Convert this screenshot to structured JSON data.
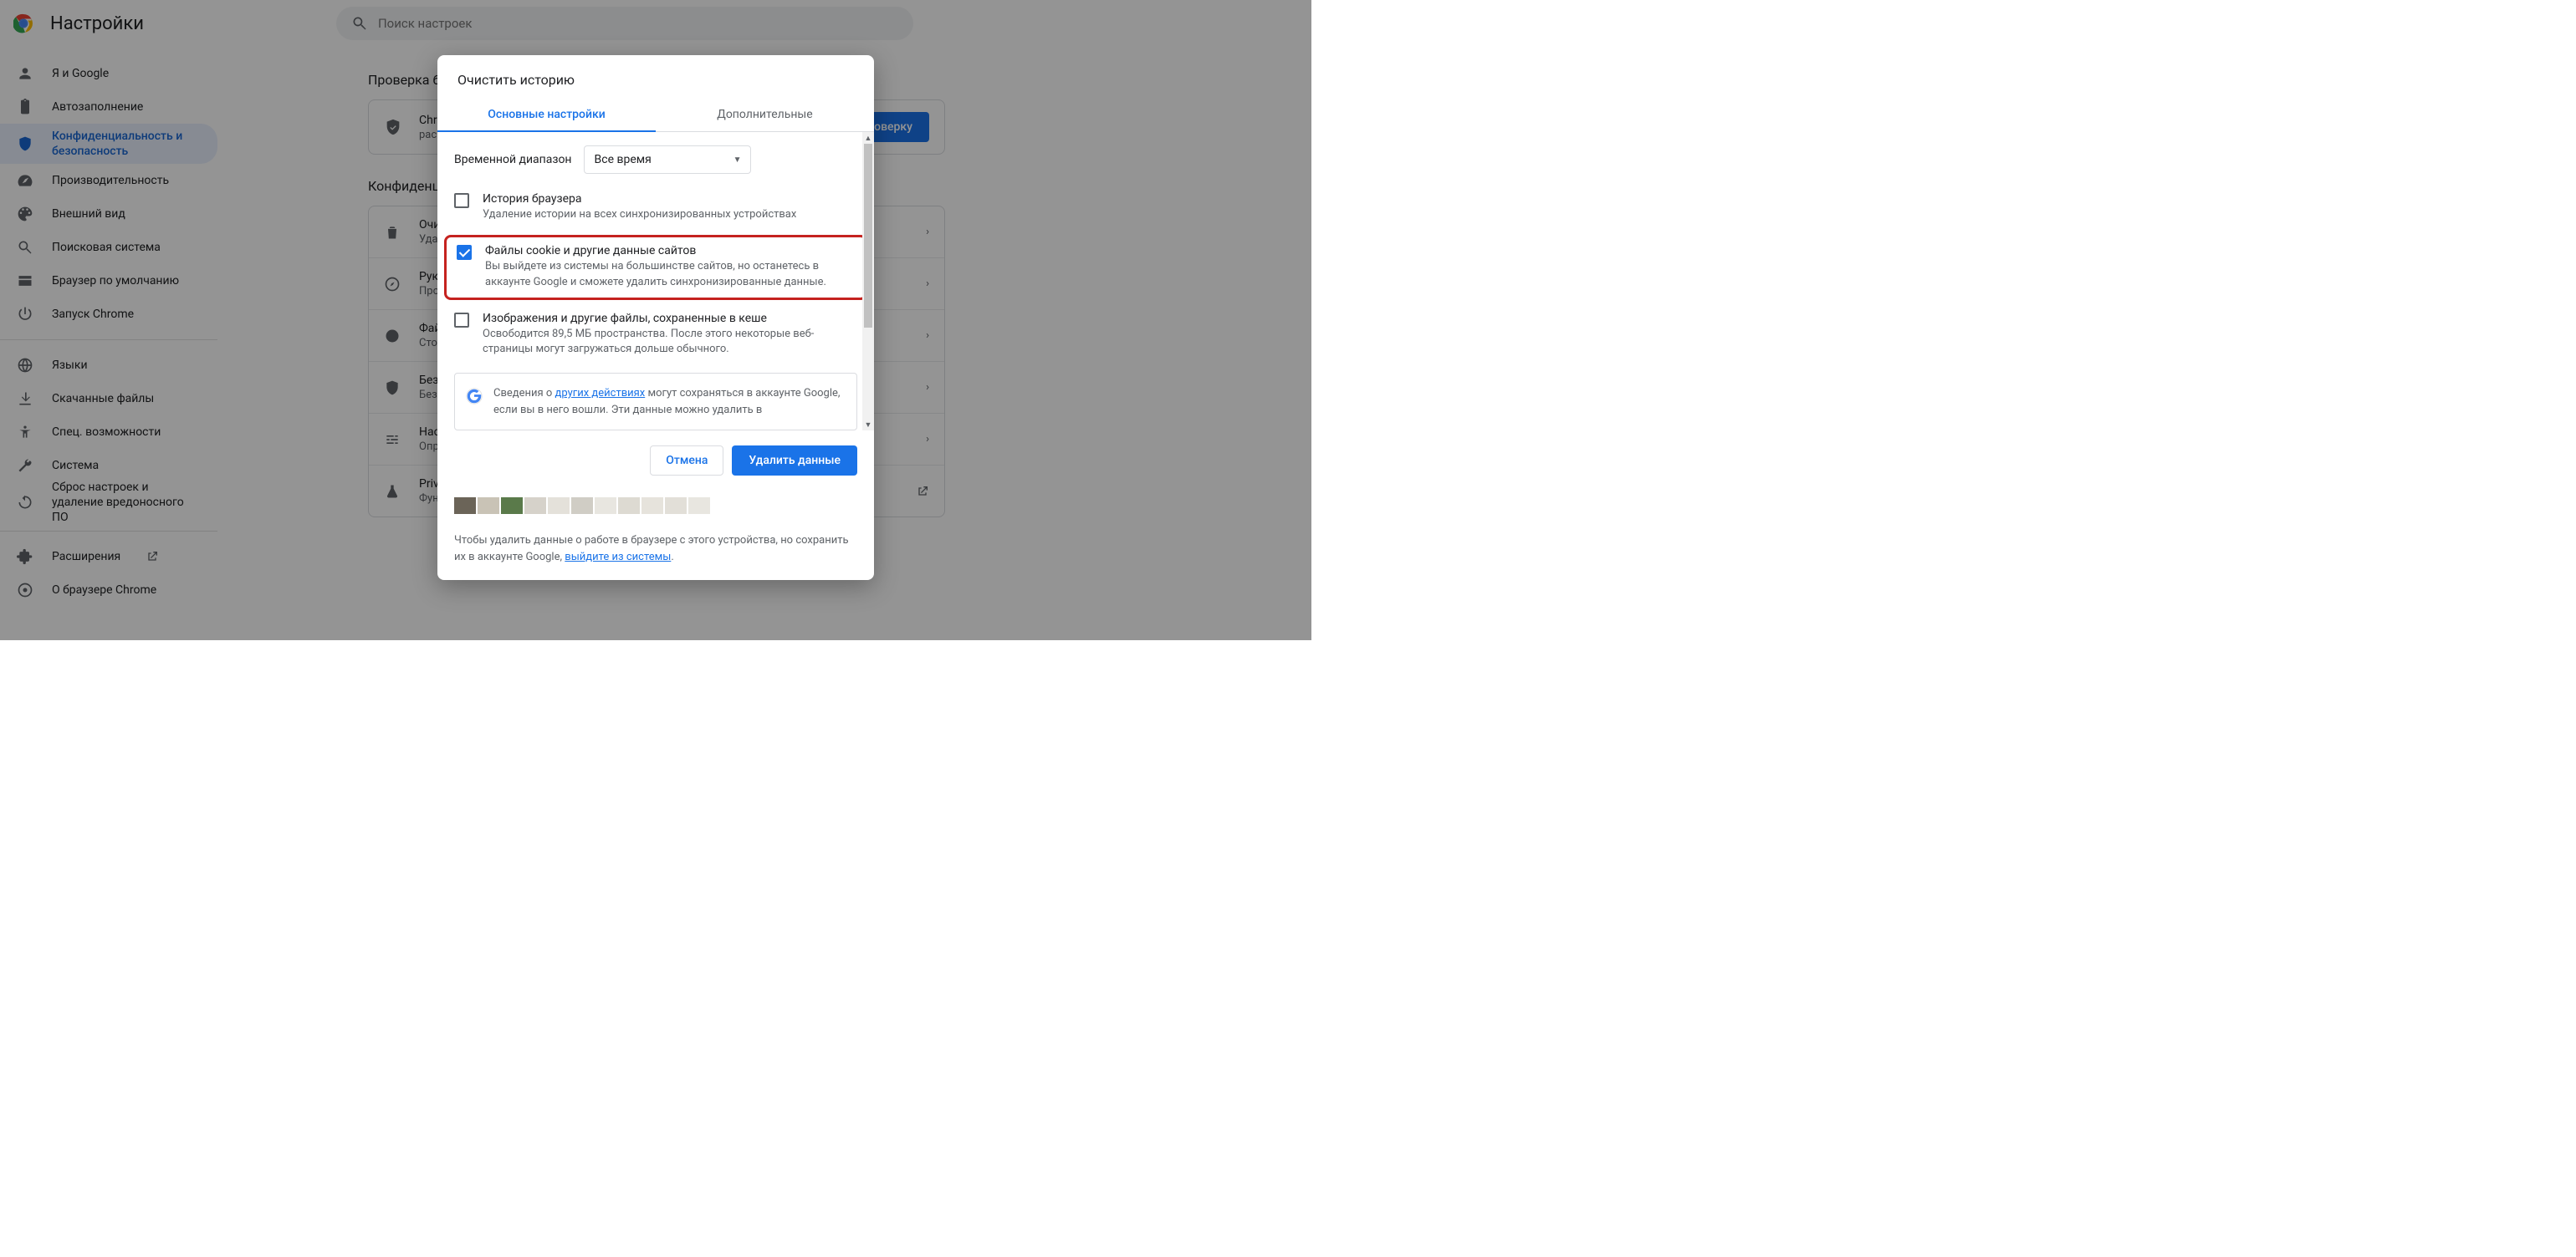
{
  "header": {
    "title": "Настройки",
    "search_placeholder": "Поиск настроек"
  },
  "sidebar": [
    "Я и Google",
    "Автозаполнение",
    "Конфиденциальность и безопасность",
    "Производительность",
    "Внешний вид",
    "Поисковая система",
    "Браузер по умолчанию",
    "Запуск Chrome",
    "Языки",
    "Скачанные файлы",
    "Спец. возможности",
    "Система",
    "Сброс настроек и удаление вредоносного ПО",
    "Расширения",
    "О браузере Chrome"
  ],
  "main": {
    "safety_check_title": "Проверка бе",
    "safety_row": {
      "t1": "Chro",
      "t2": "расш"
    },
    "run_check": "оверку",
    "privacy_title": "Конфиденци",
    "rows": [
      {
        "t1": "Очи",
        "t2": "Уда"
      },
      {
        "t1": "Рук",
        "t2": "Про"
      },
      {
        "t1": "Фай",
        "t2": "Сто"
      },
      {
        "t1": "Без",
        "t2": "Без"
      },
      {
        "t1": "Наст",
        "t2": "Опре\nли у\nокон"
      },
      {
        "t1": "Priva",
        "t2": "Фун"
      }
    ]
  },
  "dialog": {
    "title": "Очистить историю",
    "tabs": [
      "Основные настройки",
      "Дополнительные"
    ],
    "range_label": "Временной диапазон",
    "range_value": "Все время",
    "options": [
      {
        "title": "История браузера",
        "desc": "Удаление истории на всех синхронизированных устройствах",
        "checked": false
      },
      {
        "title": "Файлы cookie и другие данные сайтов",
        "desc": "Вы выйдете из системы на большинстве сайтов, но останетесь в аккаунте Google и сможете удалить синхронизированные данные.",
        "checked": true,
        "highlighted": true
      },
      {
        "title": "Изображения и другие файлы, сохраненные в кеше",
        "desc": "Освободится 89,5 МБ пространства. После этого некоторые веб-страницы могут загружаться дольше обычного.",
        "checked": false
      }
    ],
    "info": {
      "t1": "Сведения о ",
      "link": "других действиях",
      "t2": " могут сохраняться в аккаунте Google, если вы в него вошли. Эти данные можно удалить в"
    },
    "cancel": "Отмена",
    "confirm": "Удалить данные",
    "foot": {
      "t1": "Чтобы удалить данные о работе в браузере с этого устройства, но сохранить их в аккаунте Google, ",
      "link": "выйдите из системы",
      "t2": "."
    }
  }
}
